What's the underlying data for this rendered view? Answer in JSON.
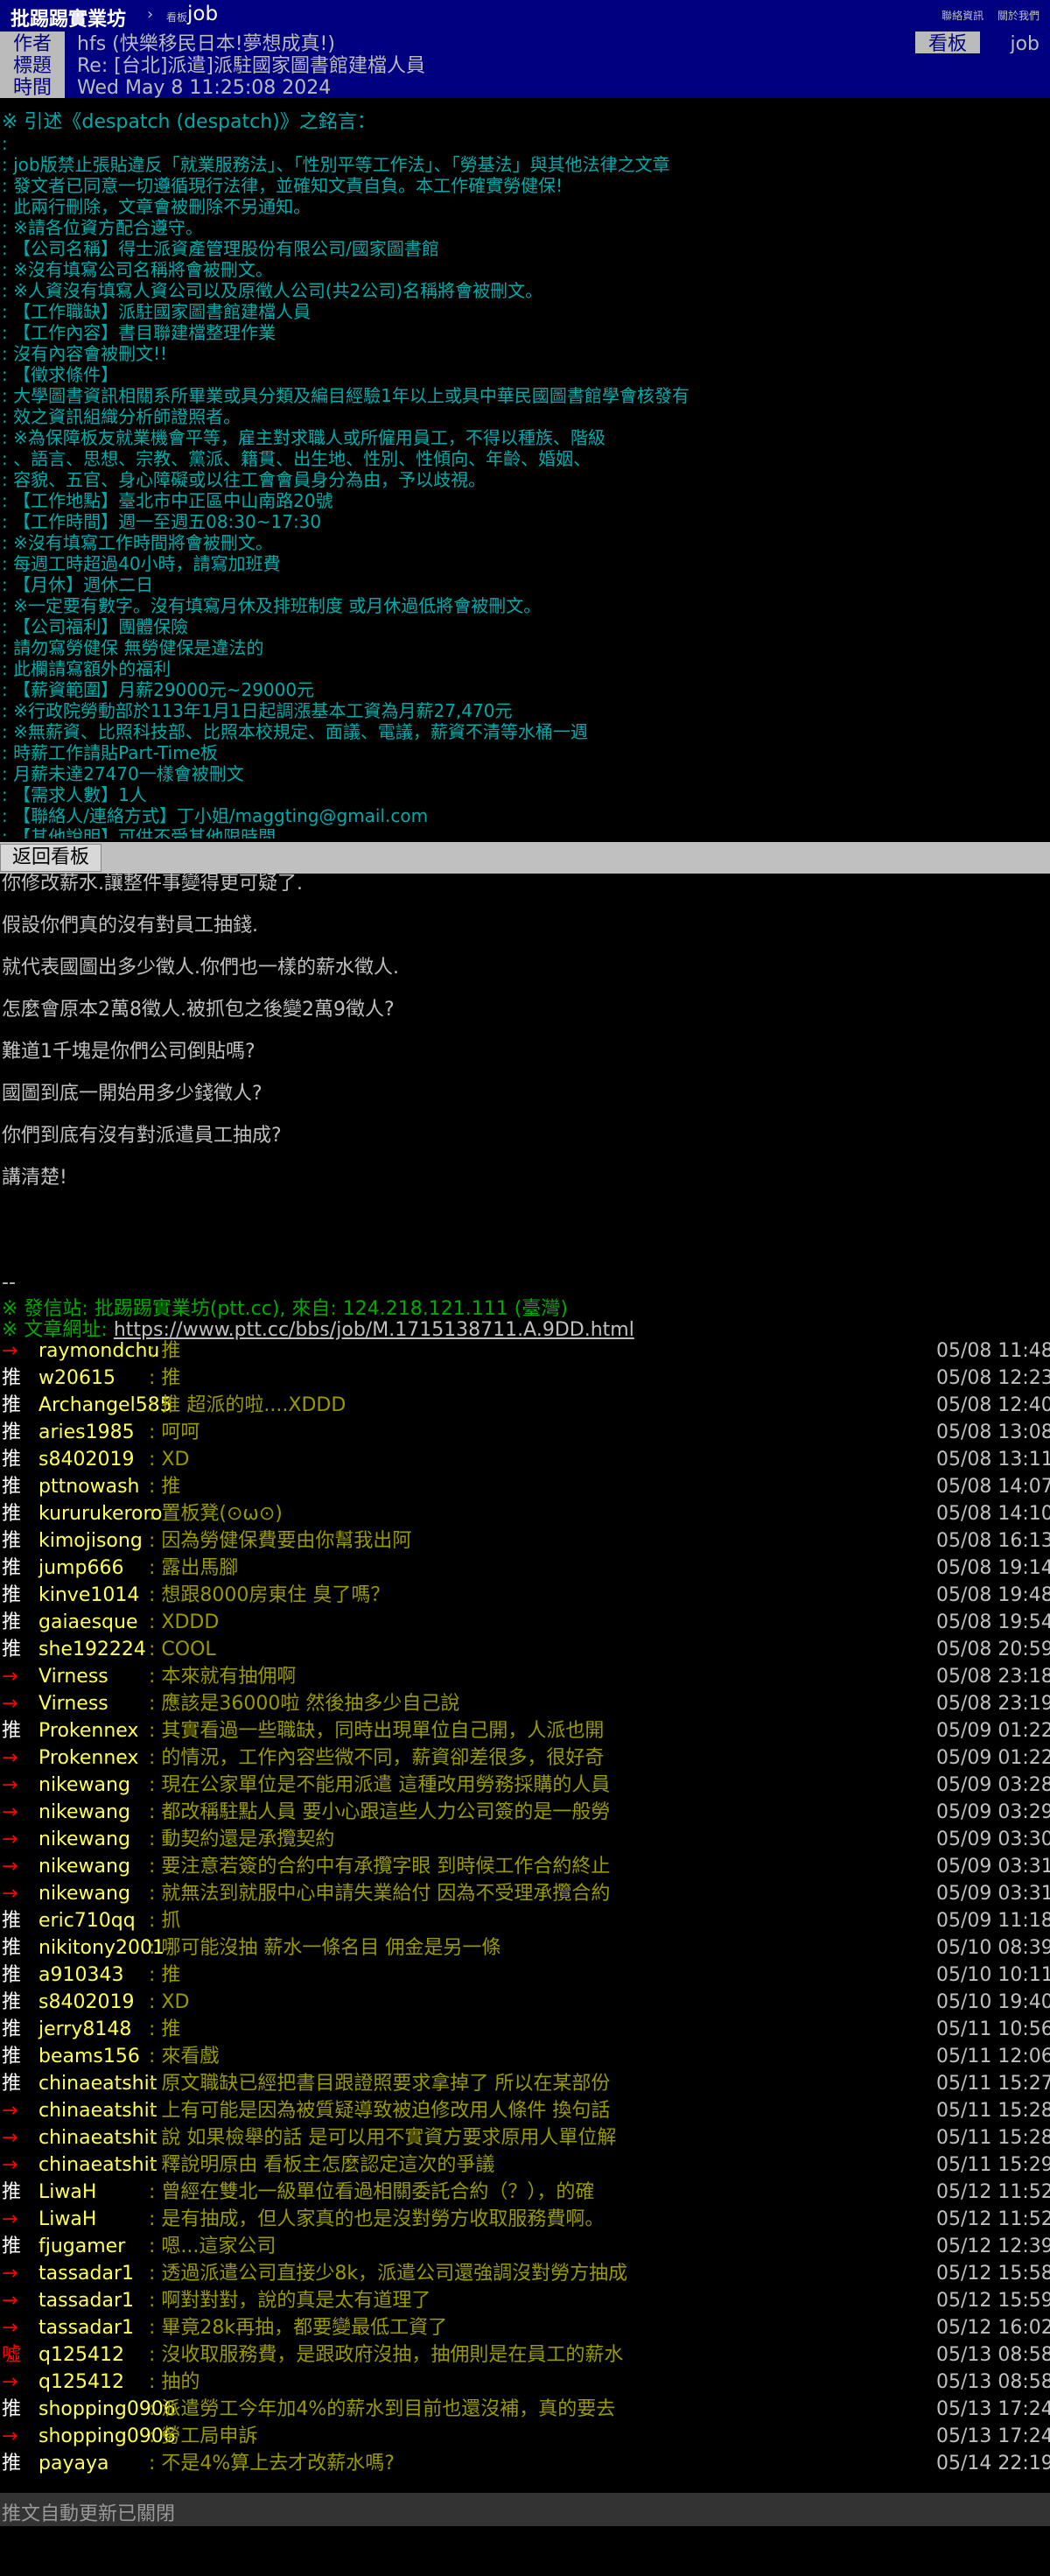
{
  "header": {
    "brand": "批踢踢實業坊",
    "arrow": "›",
    "board_prefix": "看板",
    "board_name": "job",
    "links": [
      "聯絡資訊",
      "關於我們"
    ]
  },
  "meta": {
    "author_label": "作者",
    "author_value": "hfs (快樂移民日本!夢想成真!)",
    "title_label": "標題",
    "title_value": "Re: [台北]派遣]派駐國家圖書館建檔人員",
    "time_label": "時間",
    "time_value": "Wed May  8 11:25:08 2024",
    "board_tag": "看板",
    "board_value": "job"
  },
  "quote": {
    "head": "※ 引述《despatch (despatch)》之銘言：",
    "lines": [
      ":",
      ": job版禁止張貼違反「就業服務法」、「性別平等工作法」、「勞基法」與其他法律之文章",
      ": 發文者已同意一切遵循現行法律，並確知文責自負。本工作確實勞健保!",
      ": 此兩行刪除，文章會被刪除不另通知。",
      ": ※請各位資方配合遵守。",
      ": 【公司名稱】得士派資產管理股份有限公司/國家圖書館",
      ": ※沒有填寫公司名稱將會被刪文。",
      ": ※人資沒有填寫人資公司以及原徵人公司(共2公司)名稱將會被刪文。",
      ": 【工作職缺】派駐國家圖書館建檔人員",
      ": 【工作內容】書目聯建檔整理作業",
      ":      沒有內容會被刪文!!",
      ": 【徵求條件】",
      ": 大學圖書資訊相關系所畢業或具分類及編目經驗1年以上或具中華民國圖書館學會核發有",
      ": 效之資訊組織分析師證照者。",
      ": ※為保障板友就業機會平等，雇主對求職人或所僱用員工，不得以種族、階級",
      ":   、語言、思想、宗教、黨派、籍貫、出生地、性別、性傾向、年齡、婚姻、",
      ":   容貌、五官、身心障礙或以往工會會員身分為由，予以歧視。",
      ": 【工作地點】臺北市中正區中山南路20號",
      ": 【工作時間】週一至週五08:30~17:30",
      ": ※沒有填寫工作時間將會被刪文。",
      ": 每週工時超過40小時，請寫加班費",
      ": 【月休】週休二日",
      ": ※一定要有數字。沒有填寫月休及排班制度 或月休過低將會被刪文。",
      ": 【公司福利】團體保險",
      ": 請勿寫勞健保 無勞健保是違法的",
      ": 此欄請寫額外的福利",
      ": 【薪資範圍】月薪29000元~29000元",
      ": ※行政院勞動部於113年1月1日起調漲基本工資為月薪27,470元",
      ": ※無薪資、比照科技部、比照本校規定、面議、電議，薪資不清等水桶一週",
      ": 時薪工作請貼Part-Time板",
      ": 月薪未達27470一樣會被刪文",
      ": 【需求人數】1人",
      ": 【聯絡人/連絡方式】丁小姐/maggting@gmail.com",
      ": 【其他說明】可供不受其他限時間"
    ]
  },
  "back_button": "返回看板",
  "body": [
    "你修改薪水.讓整件事變得更可疑了.",
    "假設你們真的沒有對員工抽錢.",
    "就代表國圖出多少徵人.你們也一樣的薪水徵人.",
    "怎麼會原本2萬8徵人.被抓包之後變2萬9徵人?",
    "難道1千塊是你們公司倒貼嗎?",
    "國圖到底一開始用多少錢徵人?",
    "你們到底有沒有對派遣員工抽成?",
    "講清楚!"
  ],
  "signature": {
    "dash": "--",
    "origin": "※ 發信站: 批踢踢實業坊(ptt.cc), 來自: 124.218.121.111 (臺灣)",
    "url_label": "※ 文章網址: ",
    "url": "https://www.ptt.cc/bbs/job/M.1715138711.A.9DD.html"
  },
  "pushes": [
    {
      "tag": "→",
      "type": "arrow",
      "user": "raymondchu",
      "content": ": 推",
      "time": "05/08 11:48"
    },
    {
      "tag": "推",
      "type": "up",
      "user": "w20615",
      "content": ": 推",
      "time": "05/08 12:23"
    },
    {
      "tag": "推",
      "type": "up",
      "user": "Archangel585",
      "content": ": 推 超派的啦....XDDD",
      "time": "05/08 12:40"
    },
    {
      "tag": "推",
      "type": "up",
      "user": "aries1985",
      "content": ": 呵呵",
      "time": "05/08 13:08"
    },
    {
      "tag": "推",
      "type": "up",
      "user": "s8402019",
      "content": ": XD",
      "time": "05/08 13:11"
    },
    {
      "tag": "推",
      "type": "up",
      "user": "pttnowash",
      "content": ": 推",
      "time": "05/08 14:07"
    },
    {
      "tag": "推",
      "type": "up",
      "user": "kururukeroro",
      "content": ": 置板凳(⊙ω⊙)",
      "time": "05/08 14:10"
    },
    {
      "tag": "推",
      "type": "up",
      "user": "kimojisong",
      "content": ": 因為勞健保費要由你幫我出阿",
      "time": "05/08 16:13"
    },
    {
      "tag": "推",
      "type": "up",
      "user": "jump666",
      "content": ": 露出馬腳",
      "time": "05/08 19:14"
    },
    {
      "tag": "推",
      "type": "up",
      "user": "kinve1014",
      "content": ": 想跟8000房東住 臭了嗎？",
      "time": "05/08 19:48"
    },
    {
      "tag": "推",
      "type": "up",
      "user": "gaiaesque",
      "content": ": XDDD",
      "time": "05/08 19:54"
    },
    {
      "tag": "推",
      "type": "up",
      "user": "she192224",
      "content": ": COOL",
      "time": "05/08 20:59"
    },
    {
      "tag": "→",
      "type": "arrow",
      "user": "Virness",
      "content": ": 本來就有抽佣啊",
      "time": "05/08 23:18"
    },
    {
      "tag": "→",
      "type": "arrow",
      "user": "Virness",
      "content": ": 應該是36000啦 然後抽多少自己說",
      "time": "05/08 23:19"
    },
    {
      "tag": "推",
      "type": "up",
      "user": "Prokennex",
      "content": ": 其實看過一些職缺，同時出現單位自己開，人派也開",
      "time": "05/09 01:22"
    },
    {
      "tag": "→",
      "type": "arrow",
      "user": "Prokennex",
      "content": ": 的情況，工作內容些微不同，薪資卻差很多，很好奇",
      "time": "05/09 01:22"
    },
    {
      "tag": "→",
      "type": "arrow",
      "user": "nikewang",
      "content": ": 現在公家單位是不能用派遣 這種改用勞務採購的人員",
      "time": "05/09 03:28"
    },
    {
      "tag": "→",
      "type": "arrow",
      "user": "nikewang",
      "content": ": 都改稱駐點人員 要小心跟這些人力公司簽的是一般勞",
      "time": "05/09 03:29"
    },
    {
      "tag": "→",
      "type": "arrow",
      "user": "nikewang",
      "content": ": 動契約還是承攬契約",
      "time": "05/09 03:30"
    },
    {
      "tag": "→",
      "type": "arrow",
      "user": "nikewang",
      "content": ": 要注意若簽的合約中有承攬字眼 到時候工作合約終止",
      "time": "05/09 03:31"
    },
    {
      "tag": "→",
      "type": "arrow",
      "user": "nikewang",
      "content": ": 就無法到就服中心申請失業給付 因為不受理承攬合約",
      "time": "05/09 03:31"
    },
    {
      "tag": "推",
      "type": "up",
      "user": "eric710qq",
      "content": ": 抓",
      "time": "05/09 11:18"
    },
    {
      "tag": "推",
      "type": "up",
      "user": "nikitony2001",
      "content": ": 哪可能沒抽  薪水一條名目 佣金是另一條",
      "time": "05/10 08:39"
    },
    {
      "tag": "推",
      "type": "up",
      "user": "a910343",
      "content": ": 推",
      "time": "05/10 10:11"
    },
    {
      "tag": "推",
      "type": "up",
      "user": "s8402019",
      "content": ": XD",
      "time": "05/10 19:40"
    },
    {
      "tag": "推",
      "type": "up",
      "user": "jerry8148",
      "content": ": 推",
      "time": "05/11 10:56"
    },
    {
      "tag": "推",
      "type": "up",
      "user": "beams156",
      "content": ": 來看戲",
      "time": "05/11 12:06"
    },
    {
      "tag": "推",
      "type": "up",
      "user": "chinaeatshit",
      "content": ": 原文職缺已經把書目跟證照要求拿掉了 所以在某部份",
      "time": "05/11 15:27"
    },
    {
      "tag": "→",
      "type": "arrow",
      "user": "chinaeatshit",
      "content": ": 上有可能是因為被質疑導致被迫修改用人條件 換句話",
      "time": "05/11 15:28"
    },
    {
      "tag": "→",
      "type": "arrow",
      "user": "chinaeatshit",
      "content": ": 說 如果檢舉的話 是可以用不實資方要求原用人單位解",
      "time": "05/11 15:28"
    },
    {
      "tag": "→",
      "type": "arrow",
      "user": "chinaeatshit",
      "content": ": 釋說明原由 看板主怎麼認定這次的爭議",
      "time": "05/11 15:29"
    },
    {
      "tag": "推",
      "type": "up",
      "user": "LiwaH",
      "content": ": 曾經在雙北一級單位看過相關委託合約（？），的確",
      "time": "05/12 11:52"
    },
    {
      "tag": "→",
      "type": "arrow",
      "user": "LiwaH",
      "content": ": 是有抽成，但人家真的也是沒對勞方收取服務費啊。",
      "time": "05/12 11:52"
    },
    {
      "tag": "推",
      "type": "up",
      "user": "fjugamer",
      "content": ": 嗯...這家公司",
      "time": "05/12 12:39"
    },
    {
      "tag": "→",
      "type": "arrow",
      "user": "tassadar1",
      "content": ": 透過派遣公司直接少8k，派遣公司還強調沒對勞方抽成",
      "time": "05/12 15:58"
    },
    {
      "tag": "→",
      "type": "arrow",
      "user": "tassadar1",
      "content": ": 啊對對對，說的真是太有道理了",
      "time": "05/12 15:59"
    },
    {
      "tag": "→",
      "type": "arrow",
      "user": "tassadar1",
      "content": ": 畢竟28k再抽，都要變最低工資了",
      "time": "05/12 16:02"
    },
    {
      "tag": "噓",
      "type": "down",
      "user": "q125412",
      "content": ": 沒收取服務費，是跟政府沒抽，抽佣則是在員工的薪水",
      "time": "05/13 08:58"
    },
    {
      "tag": "→",
      "type": "arrow",
      "user": "q125412",
      "content": ": 抽的",
      "time": "05/13 08:58"
    },
    {
      "tag": "推",
      "type": "up",
      "user": "shopping0906",
      "content": ": 派遣勞工今年加4%的薪水到目前也還沒補，真的要去",
      "time": "05/13 17:24"
    },
    {
      "tag": "→",
      "type": "arrow",
      "user": "shopping0906",
      "content": ": 勞工局申訴",
      "time": "05/13 17:24"
    },
    {
      "tag": "推",
      "type": "up",
      "user": "payaya",
      "content": ": 不是4%算上去才改薪水嗎?",
      "time": "05/14 22:19"
    }
  ],
  "auto_update": "推文自動更新已關閉"
}
